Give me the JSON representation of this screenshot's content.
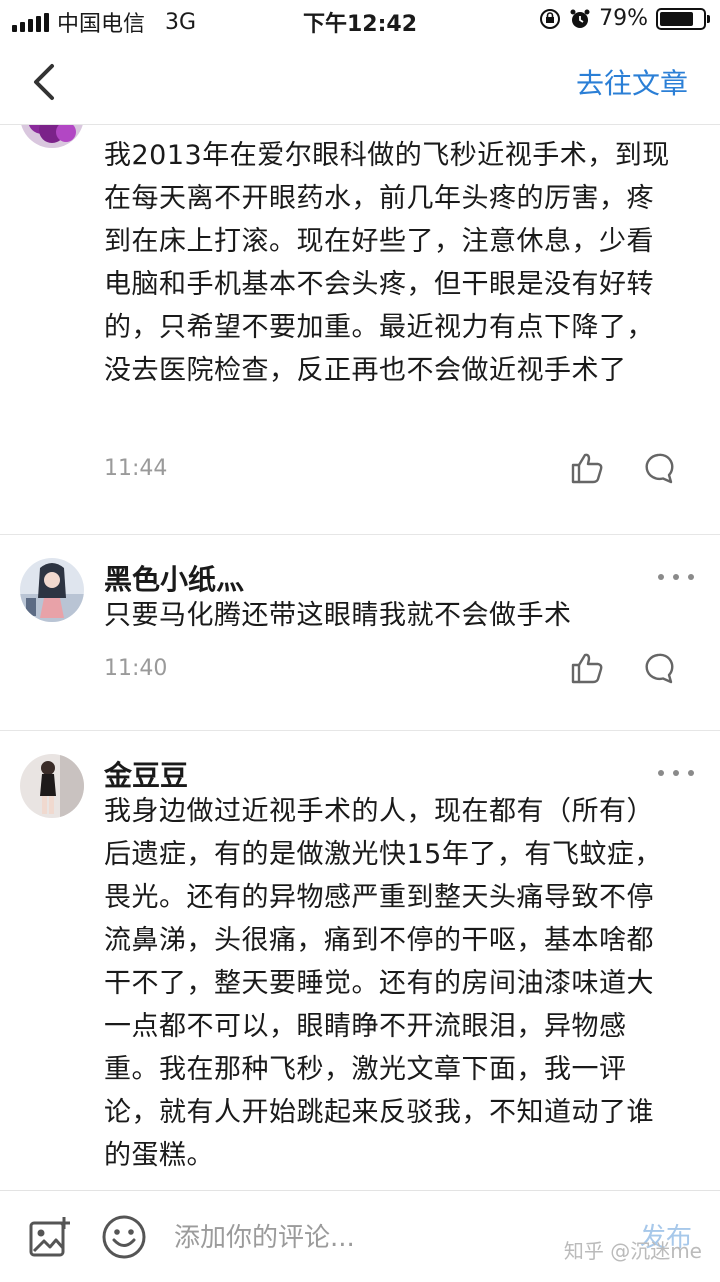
{
  "status_bar": {
    "carrier": "中国电信",
    "network": "3G",
    "time": "下午12:42",
    "battery": "79%",
    "battery_level": 0.79
  },
  "nav": {
    "go_to_article": "去往文章"
  },
  "comments": [
    {
      "text": "我2013年在爱尔眼科做的飞秒近视手术，到现在每天离不开眼药水，前几年头疼的厉害，疼到在床上打滚。现在好些了，注意休息，少看电脑和手机基本不会头疼，但干眼是没有好转的，只希望不要加重。最近视力有点下降了，没去医院检查，反正再也不会做近视手术了",
      "time": "11:44"
    },
    {
      "username": "黑色小纸灬",
      "text": "只要马化腾还带这眼睛我就不会做手术",
      "time": "11:40"
    },
    {
      "username": "金豆豆",
      "text": "我身边做过近视手术的人，现在都有（所有）后遗症，有的是做激光快15年了，有飞蚊症，畏光。还有的异物感严重到整天头痛导致不停流鼻涕，头很痛，痛到不停的干呕，基本啥都干不了，整天要睡觉。还有的房间油漆味道大一点都不可以，眼睛睁不开流眼泪，异物感重。我在那种飞秒，激光文章下面，我一评论，就有人开始跳起来反驳我，不知道动了谁的蛋糕。"
    }
  ],
  "comment_bar": {
    "placeholder": "添加你的评论...",
    "publish": "发布"
  },
  "watermark": "知乎 @沉迷me",
  "colors": {
    "accent": "#2b7fd6",
    "publish_disabled": "#a7c8ea"
  },
  "icons": [
    "back-arrow-icon",
    "more-icon",
    "like-icon",
    "reply-icon",
    "image-icon",
    "emoji-icon"
  ]
}
